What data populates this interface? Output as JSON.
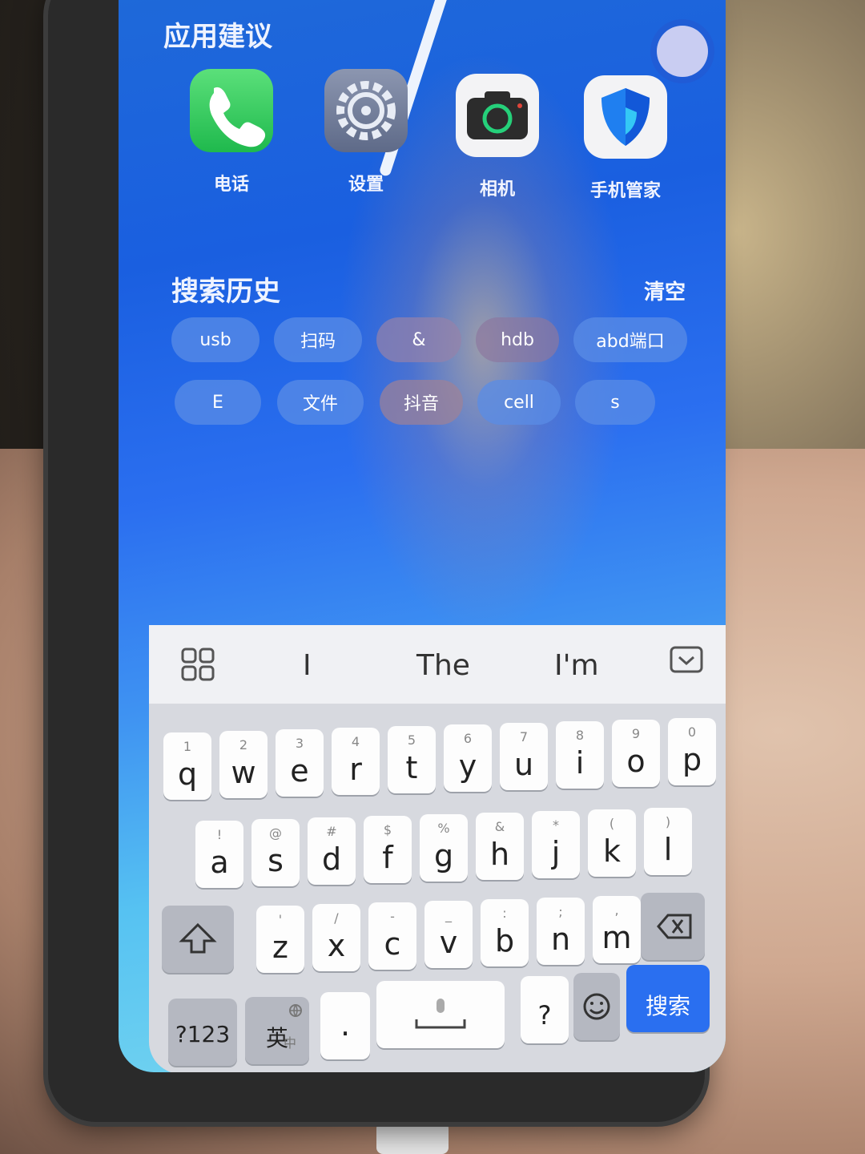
{
  "app_suggestions": {
    "title": "应用建议",
    "apps": [
      {
        "label": "电话",
        "icon": "phone-icon"
      },
      {
        "label": "设置",
        "icon": "gear-icon"
      },
      {
        "label": "相机",
        "icon": "camera-icon"
      },
      {
        "label": "手机管家",
        "icon": "shield-icon"
      }
    ]
  },
  "search_history": {
    "title": "搜索历史",
    "clear_label": "清空",
    "items": [
      "usb",
      "扫码",
      "&",
      "hdb",
      "abd端口",
      "E",
      "文件",
      "抖音",
      "cell",
      "s"
    ]
  },
  "keyboard": {
    "suggestions": [
      "I",
      "The",
      "I'm"
    ],
    "row1": [
      {
        "k": "q",
        "s": "1"
      },
      {
        "k": "w",
        "s": "2"
      },
      {
        "k": "e",
        "s": "3"
      },
      {
        "k": "r",
        "s": "4"
      },
      {
        "k": "t",
        "s": "5"
      },
      {
        "k": "y",
        "s": "6"
      },
      {
        "k": "u",
        "s": "7"
      },
      {
        "k": "i",
        "s": "8"
      },
      {
        "k": "o",
        "s": "9"
      },
      {
        "k": "p",
        "s": "0"
      }
    ],
    "row2": [
      {
        "k": "a",
        "s": "!"
      },
      {
        "k": "s",
        "s": "@"
      },
      {
        "k": "d",
        "s": "#"
      },
      {
        "k": "f",
        "s": "$"
      },
      {
        "k": "g",
        "s": "%"
      },
      {
        "k": "h",
        "s": "&"
      },
      {
        "k": "j",
        "s": "*"
      },
      {
        "k": "k",
        "s": "("
      },
      {
        "k": "l",
        "s": ")"
      }
    ],
    "row3": [
      {
        "k": "z",
        "s": "'"
      },
      {
        "k": "x",
        "s": "/"
      },
      {
        "k": "c",
        "s": "-"
      },
      {
        "k": "v",
        "s": "_"
      },
      {
        "k": "b",
        "s": ":"
      },
      {
        "k": "n",
        "s": ";"
      },
      {
        "k": "m",
        "s": ","
      }
    ],
    "num_label": "?123",
    "lang_label": "英",
    "lang_sub": "中",
    "dot_label": "·",
    "question_label": "?",
    "search_label": "搜索"
  }
}
